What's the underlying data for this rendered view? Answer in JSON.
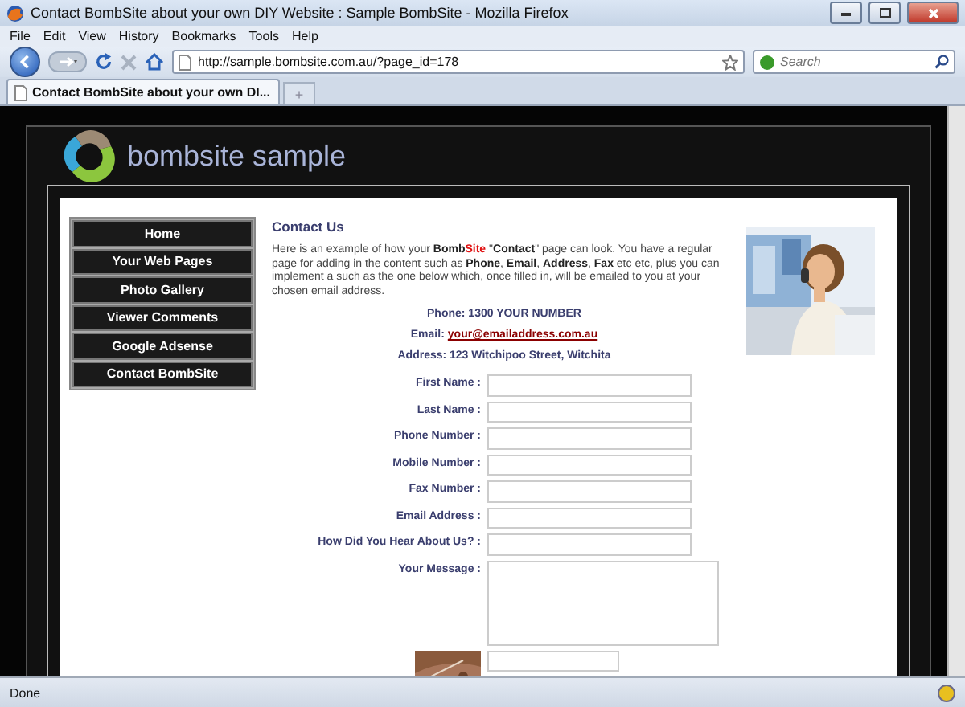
{
  "window": {
    "title": "Contact BombSite about your own DIY Website : Sample BombSite - Mozilla Firefox"
  },
  "menu": [
    "File",
    "Edit",
    "View",
    "History",
    "Bookmarks",
    "Tools",
    "Help"
  ],
  "address_bar": {
    "url": "http://sample.bombsite.com.au/?page_id=178"
  },
  "search": {
    "placeholder": "Search"
  },
  "tabs": [
    {
      "label": "Contact BombSite about your own DI...",
      "selected": true
    }
  ],
  "new_tab": "+",
  "site": {
    "name": "bombsite sample",
    "nav": [
      {
        "label": "Home",
        "selected": false
      },
      {
        "label": "Your Web Pages",
        "selected": false
      },
      {
        "label": "Photo Gallery",
        "selected": false
      },
      {
        "label": "Viewer Comments",
        "selected": false
      },
      {
        "label": "Google Adsense",
        "selected": false
      },
      {
        "label": "Contact BombSite",
        "selected": false
      }
    ],
    "heading": "Contact Us",
    "intro": [
      {
        "kind": "plain",
        "text": "Here is an example of how your "
      },
      {
        "kind": "bold",
        "text": "Bomb"
      },
      {
        "kind": "red",
        "text": "Site"
      },
      {
        "kind": "plain",
        "text": " \""
      },
      {
        "kind": "bold",
        "text": "Contact"
      },
      {
        "kind": "plain",
        "text": "\" page can look. You have a regular page for adding in the content such as "
      },
      {
        "kind": "bold",
        "text": "Phone"
      },
      {
        "kind": "plain",
        "text": ", "
      },
      {
        "kind": "bold",
        "text": "Email"
      },
      {
        "kind": "plain",
        "text": ", "
      },
      {
        "kind": "bold",
        "text": "Address"
      },
      {
        "kind": "plain",
        "text": ", "
      },
      {
        "kind": "bold",
        "text": "Fax"
      },
      {
        "kind": "plain",
        "text": " etc etc, plus you can implement a such as the one below which, once filled in, will be emailed to you at your chosen email address."
      }
    ],
    "phone": "Phone: 1300 YOUR NUMBER",
    "email_label": "Email:",
    "email_link": "your@emailaddress.com.au",
    "address": "Address: 123 Witchipoo Street, Witchita",
    "form": [
      {
        "kind": "line",
        "label": "First Name :"
      },
      {
        "kind": "line",
        "label": "Last Name :"
      },
      {
        "kind": "line",
        "label": "Phone Number :"
      },
      {
        "kind": "line",
        "label": "Mobile Number :"
      },
      {
        "kind": "line",
        "label": "Fax Number :"
      },
      {
        "kind": "line",
        "label": "Email Address :"
      },
      {
        "kind": "line",
        "label": "How Did You Hear About Us? :"
      },
      {
        "kind": "area",
        "label": "Your Message :"
      },
      {
        "kind": "captcha"
      }
    ]
  },
  "status_bar": {
    "text": "Done"
  }
}
